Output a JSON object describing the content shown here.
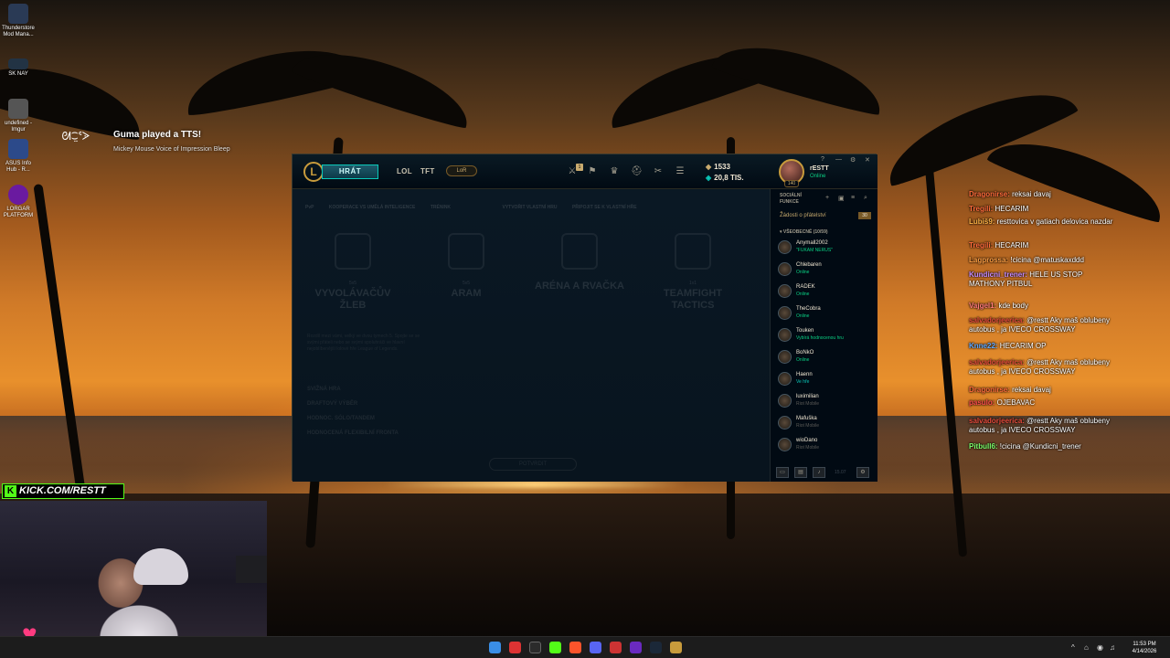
{
  "desktop_icons": [
    {
      "label": "Thunderstore Mod Mana...",
      "color": "#2a3a55"
    },
    {
      "label": "SK NAY",
      "color": "#223344"
    },
    {
      "label": "undefined - Imgur",
      "color": "#555"
    },
    {
      "label": "ASUS Info Hub - R...",
      "color": "#2c4a8a"
    },
    {
      "label": "LORGAR PLATFORM",
      "color": "#6a1aa0"
    }
  ],
  "notification": {
    "logo": "ᘛ⁐̤ᕐᐷ",
    "title": "Guma played a TTS!",
    "subtitle": "Mickey Mouse Voice of Impression Bleep"
  },
  "client": {
    "play_label": "HRÁT",
    "nav": [
      "LOL",
      "TFT"
    ],
    "lor_label": "LoR",
    "task_badge": "1",
    "blue_essence": "1533",
    "riot_points": "20,8 TIS.",
    "level": "140",
    "username": "rESTT",
    "user_status": "Online",
    "subtabs": [
      "PvP",
      "KOOPERACE VS UMĚLÁ INTELIGENCE",
      "TRÉNINK",
      "VYTVOŘIT VLASTNÍ HRU",
      "PŘIPOJIT SE K VLASTNÍ HŘE"
    ],
    "modes": [
      {
        "tag": "5v5",
        "name": "VYVOLÁVAČŮV ŽLEB"
      },
      {
        "tag": "5v5",
        "name": "ARAM"
      },
      {
        "tag": "",
        "name": "ARÉNA A RVAČKA"
      },
      {
        "tag": "1v1",
        "name": "TEAMFIGHT TACTICS"
      }
    ],
    "description": "Rozdíl mezi vámi, velký ve dvou tymech 5. Spojte se se svými přáteli nebo se svými spoluhráči ve hlavní nejoblíbenější lolové hře League of Legends.",
    "queues": [
      "SVIŽNÁ HRA",
      "DRAFTOVÝ VÝBĚR",
      "HODNOC. SÓLO/TANDEM",
      "HODNOCENÁ FLEXIBILNÍ FRONTA"
    ],
    "confirm_label": "POTVRDIT"
  },
  "social": {
    "title": "SOCIÁLNÍ FUNKCE",
    "friend_requests": "Žádosti o přátelství",
    "friend_request_count": "30",
    "group": "VŠEOBECNÉ (10/59)",
    "friends": [
      {
        "name": "Anymall2002",
        "status": "\"FUKAM NERUS\"",
        "color": "#0acf83"
      },
      {
        "name": "Chlebaren",
        "status": "Online",
        "color": "#0acf83"
      },
      {
        "name": "RADEK",
        "status": "Online",
        "color": "#0acf83"
      },
      {
        "name": "TheCobra",
        "status": "Online",
        "color": "#0acf83"
      },
      {
        "name": "Touken",
        "status": "Vybírá hodnocenou hru",
        "color": "#0acf83"
      },
      {
        "name": "BoNkO",
        "status": "Online",
        "color": "#0acf83"
      },
      {
        "name": "Haenn",
        "status": "Ve hře",
        "color": "#0ac8b9"
      },
      {
        "name": "luximilian",
        "status": "Riot Mobile",
        "color": "#5b5a56"
      },
      {
        "name": "Mafuška",
        "status": "Riot Mobile",
        "color": "#5b5a56"
      },
      {
        "name": "wioDano",
        "status": "Riot Mobile",
        "color": "#5b5a56"
      }
    ],
    "patch": "15.07"
  },
  "chat": [
    {
      "user": "Dragonirse:",
      "msg": " reksai davaj",
      "color": "#ff6b3b"
    },
    {
      "user": "Tregili:",
      "msg": " HECARIM",
      "color": "#ff6b3b"
    },
    {
      "user": "Lubiš9:",
      "msg": " resttovica v gatiach delovica nazdar",
      "color": "#ffb347"
    },
    {
      "user": "Tregili:",
      "msg": " HECARIM",
      "color": "#ff6b3b"
    },
    {
      "user": "Lagprossa:",
      "msg": " !cicina @matuskaxddd",
      "color": "#ff9f43"
    },
    {
      "user": "Kundicni_trener:",
      "msg": " HELE US STOP MATHONY PITBUL",
      "color": "#c58bff"
    },
    {
      "user": "Vajgel1:",
      "msg": " kde body",
      "color": "#ff7a7a"
    },
    {
      "user": "salvadorjeerica:",
      "msg": " @restt Aky maš oblubeny autobus , ja IVECO CROSSWAY",
      "color": "#e74c3c"
    },
    {
      "user": "Knne22:",
      "msg": " HECARIM OP",
      "color": "#5fa8ff"
    },
    {
      "user": "salvadorjeerica:",
      "msg": " @restt Aky maš oblubeny autobus , ja IVECO CROSSWAY",
      "color": "#e74c3c"
    },
    {
      "user": "Dragonirse:",
      "msg": " reksai davaj",
      "color": "#ff6b3b"
    },
    {
      "user": "pasulo:",
      "msg": " OJEBAVAC",
      "color": "#ff4d4d"
    },
    {
      "user": "salvadorjeerica:",
      "msg": " @restt Aky maš oblubeny autobus , ja IVECO CROSSWAY",
      "color": "#e74c3c"
    },
    {
      "user": "Pitbull6:",
      "msg": " !cicina @Kundicni_trener",
      "color": "#7dff6b"
    }
  ],
  "kick_label": "KICK.COM/RESTT",
  "clock": {
    "time": "11:53 PM",
    "date": "4/14/2026"
  }
}
